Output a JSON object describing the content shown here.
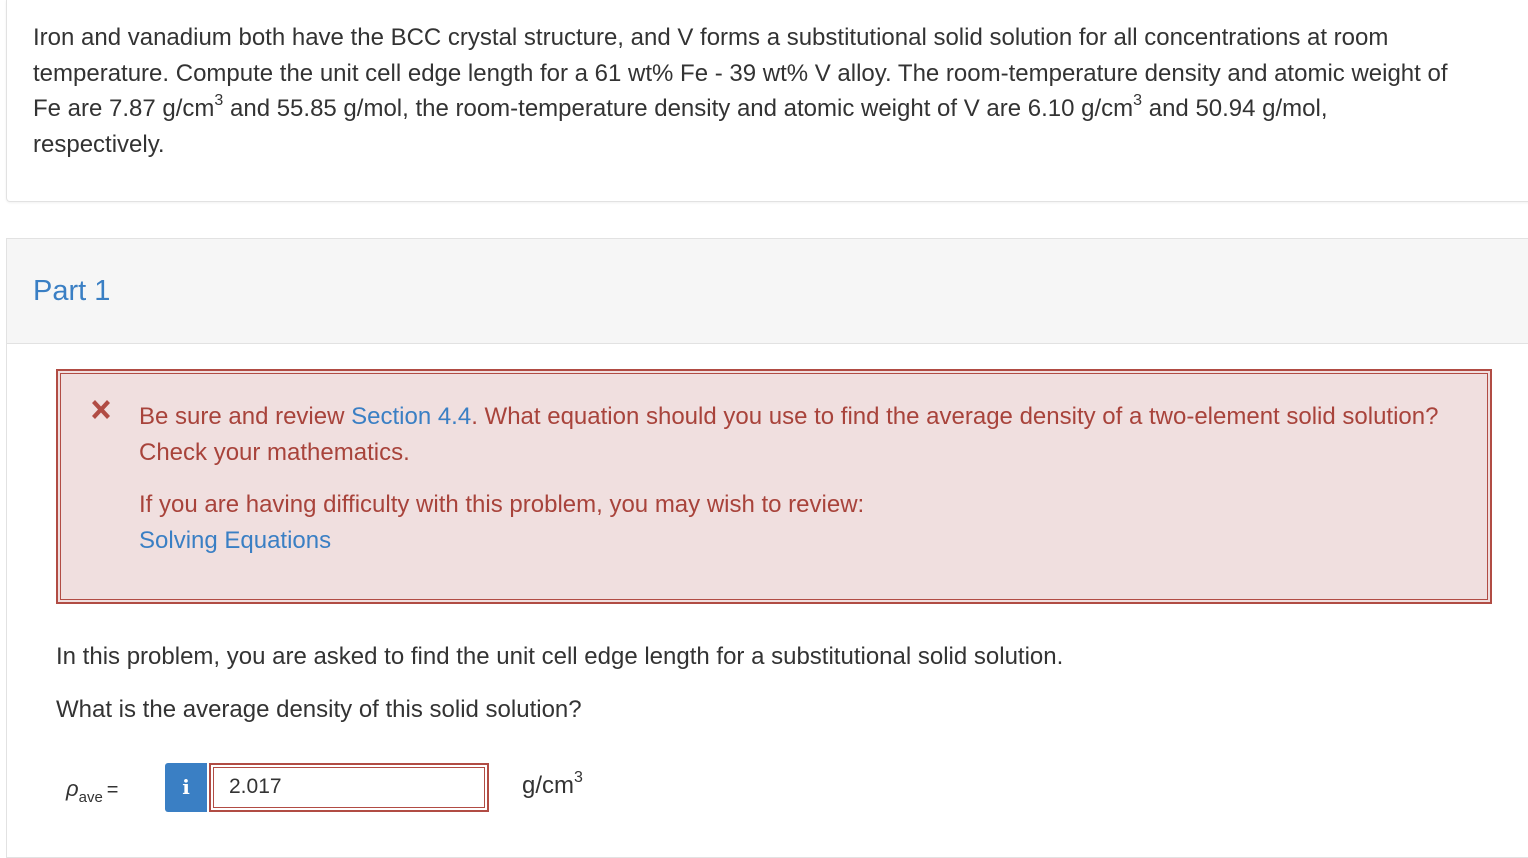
{
  "question": {
    "line1": "Iron and vanadium both have the BCC crystal structure, and V forms a substitutional solid solution for all concentrations at room",
    "line2": "temperature. Compute the unit cell edge length for a 61 wt% Fe - 39 wt% V alloy. The room-temperature density and atomic weight of",
    "line3a": "Fe are 7.87 g/cm",
    "line3b": " and 55.85 g/mol, the room-temperature density and atomic weight of V are 6.10 g/cm",
    "line3c": " and 50.94 g/mol,",
    "line4": "respectively.",
    "sup": "3"
  },
  "part": {
    "title": "Part 1"
  },
  "feedback": {
    "lead": "Be sure and review ",
    "section_link": "Section 4.4",
    "rest": ". What equation should you use to find the average density of a two-element solid solution? Check your mathematics.",
    "review_text": "If you are having difficulty with this problem, you may wish to review:",
    "review_link": "Solving Equations",
    "icon": "x-mark-icon"
  },
  "instructions": {
    "intro": "In this problem, you are asked to find the unit cell edge length for a substitutional solid solution.",
    "prompt": "What is the average density of this solid solution?"
  },
  "answer": {
    "symbol": "ρ",
    "subscript": "ave",
    "equals": "=",
    "info_label": "i",
    "value": "2.017",
    "unit": "g/cm",
    "unit_sup": "3"
  },
  "colors": {
    "link": "#3a7fc4",
    "error": "#b14c44",
    "error_bg": "#f0dfdf"
  }
}
